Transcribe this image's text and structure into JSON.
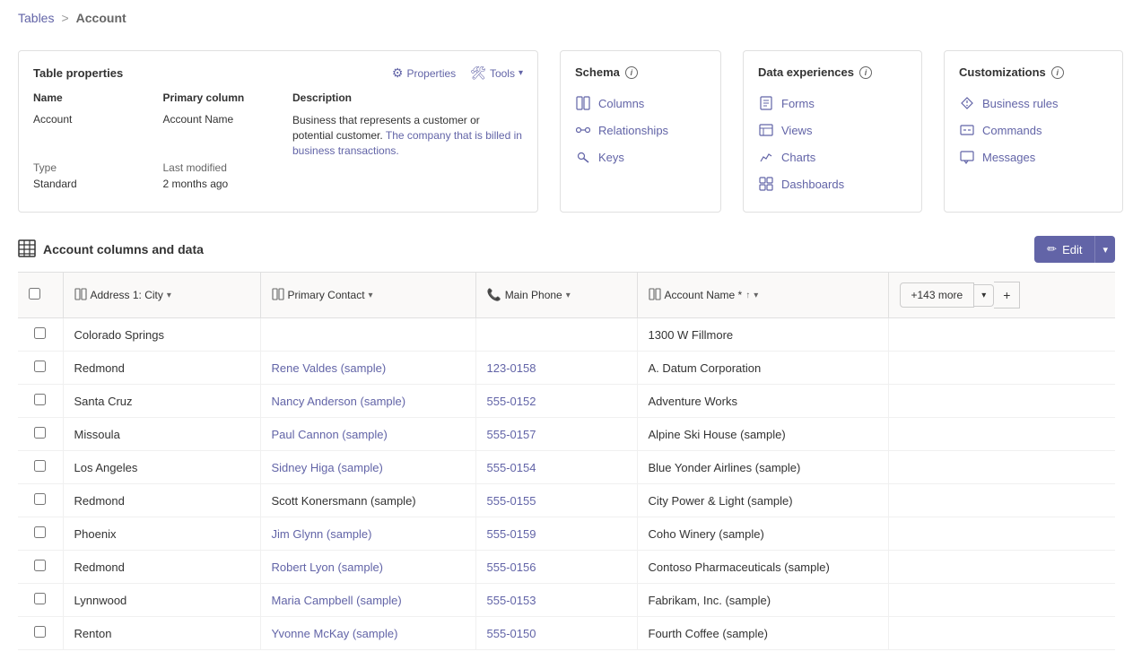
{
  "breadcrumb": {
    "parent": "Tables",
    "separator": ">",
    "current": "Account"
  },
  "tableProps": {
    "title": "Table properties",
    "propertiesLabel": "Properties",
    "toolsLabel": "Tools",
    "columns": {
      "name": "Name",
      "primaryColumn": "Primary column",
      "description": "Description"
    },
    "rows": {
      "name": "Account",
      "type": "Type",
      "typeValue": "Standard",
      "primaryColumn": "Account Name",
      "lastModified": "Last modified",
      "lastModifiedValue": "2 months ago",
      "description": "Business that represents a customer or potential customer.",
      "descriptionLink": "The company that is billed in business transactions."
    }
  },
  "schema": {
    "title": "Schema",
    "infoIcon": "i",
    "links": [
      {
        "label": "Columns",
        "icon": "columns"
      },
      {
        "label": "Relationships",
        "icon": "relationships"
      },
      {
        "label": "Keys",
        "icon": "keys"
      }
    ]
  },
  "dataExperiences": {
    "title": "Data experiences",
    "infoIcon": "i",
    "links": [
      {
        "label": "Forms",
        "icon": "forms"
      },
      {
        "label": "Views",
        "icon": "views"
      },
      {
        "label": "Charts",
        "icon": "charts"
      },
      {
        "label": "Dashboards",
        "icon": "dashboards"
      }
    ]
  },
  "customizations": {
    "title": "Customizations",
    "infoIcon": "i",
    "links": [
      {
        "label": "Business rules",
        "icon": "business-rules"
      },
      {
        "label": "Commands",
        "icon": "commands"
      },
      {
        "label": "Messages",
        "icon": "messages"
      }
    ]
  },
  "dataSection": {
    "title": "Account columns and data",
    "editLabel": "Edit",
    "moreLabel": "+143 more",
    "addLabel": "+"
  },
  "tableColumns": {
    "headers": [
      {
        "label": "Address 1: City",
        "icon": "grid",
        "hasChevron": true
      },
      {
        "label": "Primary Contact",
        "icon": "grid",
        "hasChevron": true
      },
      {
        "label": "Main Phone",
        "icon": "phone",
        "hasChevron": true
      },
      {
        "label": "Account Name *",
        "icon": "grid",
        "hasSort": true,
        "hasChevron": true
      }
    ]
  },
  "tableRows": [
    {
      "city": "Colorado Springs",
      "contact": "",
      "phone": "",
      "account": "1300 W Fillmore",
      "contactIsLink": false
    },
    {
      "city": "Redmond",
      "contact": "Rene Valdes (sample)",
      "phone": "123-0158",
      "account": "A. Datum Corporation",
      "contactIsLink": true
    },
    {
      "city": "Santa Cruz",
      "contact": "Nancy Anderson (sample)",
      "phone": "555-0152",
      "account": "Adventure Works",
      "contactIsLink": true
    },
    {
      "city": "Missoula",
      "contact": "Paul Cannon (sample)",
      "phone": "555-0157",
      "account": "Alpine Ski House (sample)",
      "contactIsLink": true
    },
    {
      "city": "Los Angeles",
      "contact": "Sidney Higa (sample)",
      "phone": "555-0154",
      "account": "Blue Yonder Airlines (sample)",
      "contactIsLink": true
    },
    {
      "city": "Redmond",
      "contact": "Scott Konersmann (sample)",
      "phone": "555-0155",
      "account": "City Power & Light (sample)",
      "contactIsLink": false
    },
    {
      "city": "Phoenix",
      "contact": "Jim Glynn (sample)",
      "phone": "555-0159",
      "account": "Coho Winery (sample)",
      "contactIsLink": true
    },
    {
      "city": "Redmond",
      "contact": "Robert Lyon (sample)",
      "phone": "555-0156",
      "account": "Contoso Pharmaceuticals (sample)",
      "contactIsLink": true
    },
    {
      "city": "Lynnwood",
      "contact": "Maria Campbell (sample)",
      "phone": "555-0153",
      "account": "Fabrikam, Inc. (sample)",
      "contactIsLink": true
    },
    {
      "city": "Renton",
      "contact": "Yvonne McKay (sample)",
      "phone": "555-0150",
      "account": "Fourth Coffee (sample)",
      "contactIsLink": true
    }
  ]
}
